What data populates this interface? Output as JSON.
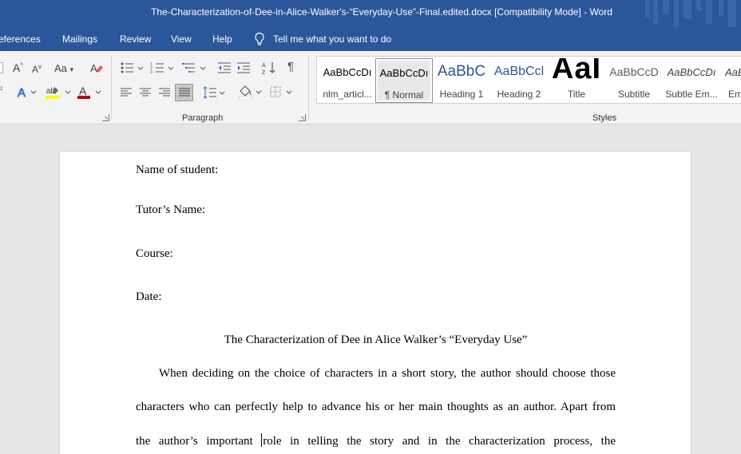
{
  "window": {
    "title": "The-Characterization-of-Dee-in-Alice-Walker's-“Everyday-Use”-Final.edited.docx [Compatibility Mode]  -  Word"
  },
  "menu": {
    "tabs": [
      "eferences",
      "Mailings",
      "Review",
      "View",
      "Help"
    ],
    "tell_me": "Tell me what you want to do"
  },
  "ribbon": {
    "font_group": {
      "grow_font": "A",
      "shrink_font": "A",
      "change_case": "Aa"
    },
    "paragraph_group": {
      "label": "Paragraph"
    },
    "styles_group": {
      "label": "Styles"
    },
    "styles": [
      {
        "preview": "AaBbCcDı",
        "name": "nlm_articl...",
        "color": "#000000"
      },
      {
        "preview": "AaBbCcDı",
        "name": "¶ Normal",
        "color": "#000000",
        "selected": true
      },
      {
        "preview": "AaBbC",
        "name": "Heading 1",
        "color": "#2f5496"
      },
      {
        "preview": "AaBbCcl",
        "name": "Heading 2",
        "color": "#2f5496"
      },
      {
        "preview": "AaI",
        "name": "Title",
        "color": "#000000"
      },
      {
        "preview": "AaBbCcD",
        "name": "Subtitle",
        "color": "#5a5a5a"
      },
      {
        "preview": "AaBbCcDı",
        "name": "Subtle Em...",
        "color": "#404040"
      },
      {
        "preview": "AaBb",
        "name": "Em",
        "color": "#404040"
      }
    ]
  },
  "document": {
    "fields": [
      "Name of student:",
      "Tutor’s Name:",
      "Course:",
      "Date:"
    ],
    "heading": "The Characterization of Dee in Alice Walker’s “Everyday Use”",
    "body_lines": [
      "When deciding on the choice of characters in a short story, the author should choose those",
      "characters who can perfectly help to advance his or her main thoughts as an author. Apart from"
    ],
    "line3_before_caret": "the author’s important ",
    "line3_after_caret": "role in telling the story and in the characterization process, the"
  }
}
